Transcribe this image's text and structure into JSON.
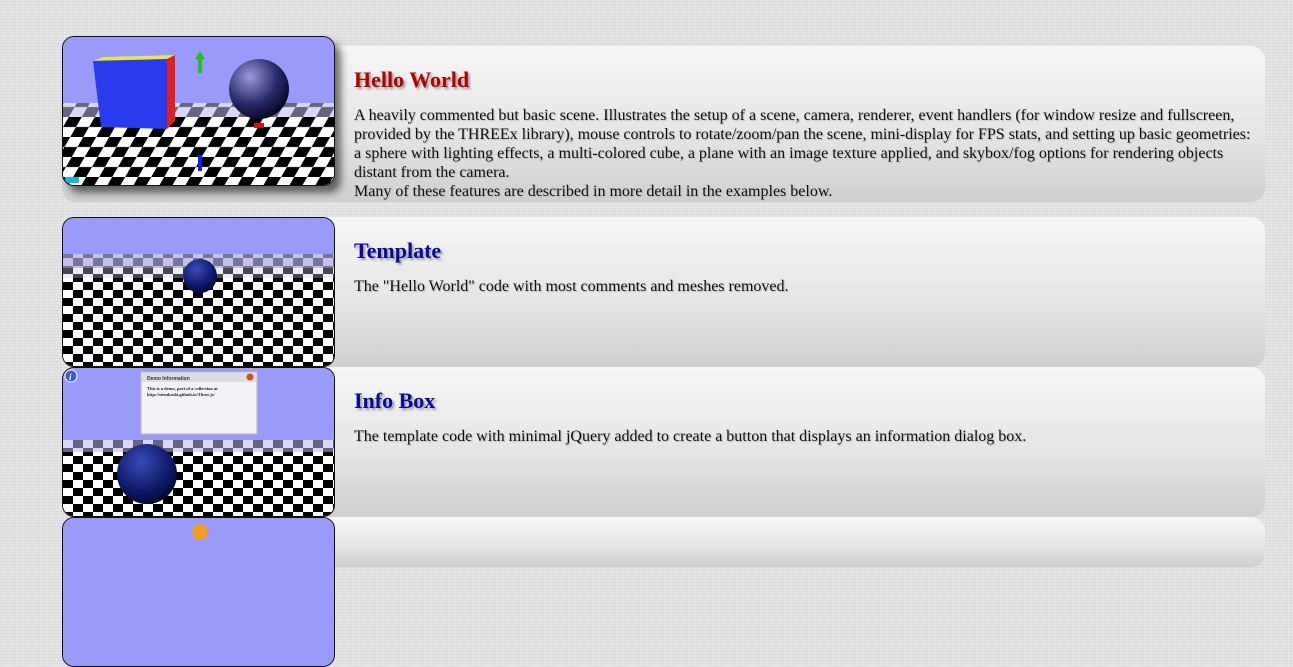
{
  "demos": [
    {
      "title": "Hello World",
      "description": "A heavily commented but basic scene. Illustrates the setup of a scene, camera, renderer, event handlers (for window resize and fullscreen, provided by the THREEx library), mouse controls to rotate/zoom/pan the scene, mini-display for FPS stats, and setting up basic geometries: a sphere with lighting effects, a multi-colored cube, a plane with an image texture applied, and skybox/fog options for rendering objects distant from the camera.",
      "description_extra": "Many of these features are described in more detail in the examples below."
    },
    {
      "title": "Template",
      "description": "The \"Hello World\" code with most comments and meshes removed."
    },
    {
      "title": "Info Box",
      "description": "The template code with minimal jQuery added to create a button that displays an information dialog box.",
      "dialog": {
        "heading": "Demo Information",
        "line1": "This is a demo, part of a collection at",
        "line2": "http://stemkoski.github.io/Three.js/"
      }
    }
  ],
  "colors": {
    "title_red": "#b30000",
    "title_blue": "#0a0a9a",
    "sky": "#9a9afa"
  }
}
